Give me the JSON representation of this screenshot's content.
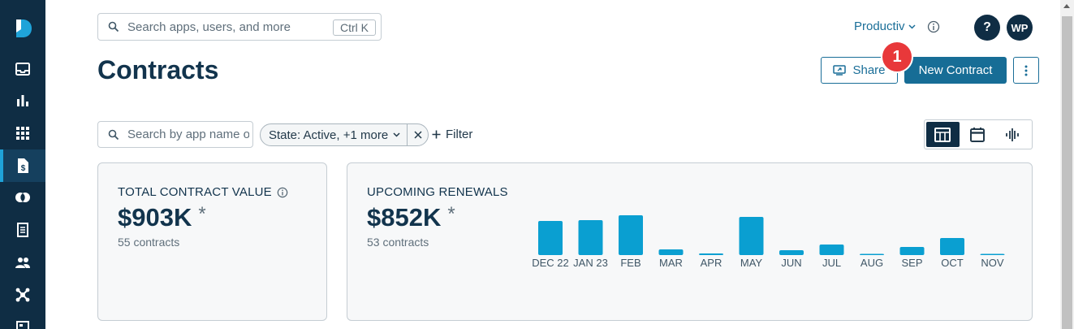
{
  "sidebar": {
    "logo_icon": "productiv-logo",
    "items": [
      {
        "icon": "inbox-icon",
        "label": "Inbox"
      },
      {
        "icon": "bar-chart-icon",
        "label": "Insights"
      },
      {
        "icon": "grid-icon",
        "label": "Applications"
      },
      {
        "icon": "contract-icon",
        "label": "Contracts",
        "active": true
      },
      {
        "icon": "rings-icon",
        "label": "Overlaps"
      },
      {
        "icon": "ledger-icon",
        "label": "Spend"
      },
      {
        "icon": "people-icon",
        "label": "Users"
      },
      {
        "icon": "network-icon",
        "label": "Integrations"
      }
    ]
  },
  "header": {
    "search_placeholder": "Search apps, users, and more",
    "search_shortcut": "Ctrl K",
    "org_name": "Productiv",
    "help_label": "?",
    "avatar_initials": "WP"
  },
  "page": {
    "title": "Contracts",
    "share_label": "Share",
    "new_contract_label": "New Contract",
    "step_badge": "1"
  },
  "filters": {
    "app_search_placeholder": "Search by app name o",
    "state_chip": "State: Active, +1 more",
    "add_filter_label": "Filter"
  },
  "cards": {
    "total": {
      "label": "TOTAL CONTRACT VALUE",
      "value": "$903K",
      "asterisk": "*",
      "sub": "55 contracts"
    },
    "renewals": {
      "label": "UPCOMING RENEWALS",
      "value": "$852K",
      "asterisk": "*",
      "sub": "53 contracts"
    }
  },
  "chart_data": {
    "type": "bar",
    "categories": [
      "DEC 22",
      "JAN 23",
      "FEB",
      "MAR",
      "APR",
      "MAY",
      "JUN",
      "JUL",
      "AUG",
      "SEP",
      "OCT",
      "NOV"
    ],
    "values": [
      42,
      43,
      49,
      7,
      2,
      47,
      6,
      13,
      1,
      10,
      21,
      1
    ],
    "ylim": [
      0,
      50
    ],
    "color": "#0a9fd1",
    "grid": false,
    "legend": "none"
  },
  "colors": {
    "sidebar_bg": "#0f2d44",
    "accent": "#176d96",
    "bar": "#0a9fd1",
    "badge": "#e8383a"
  }
}
